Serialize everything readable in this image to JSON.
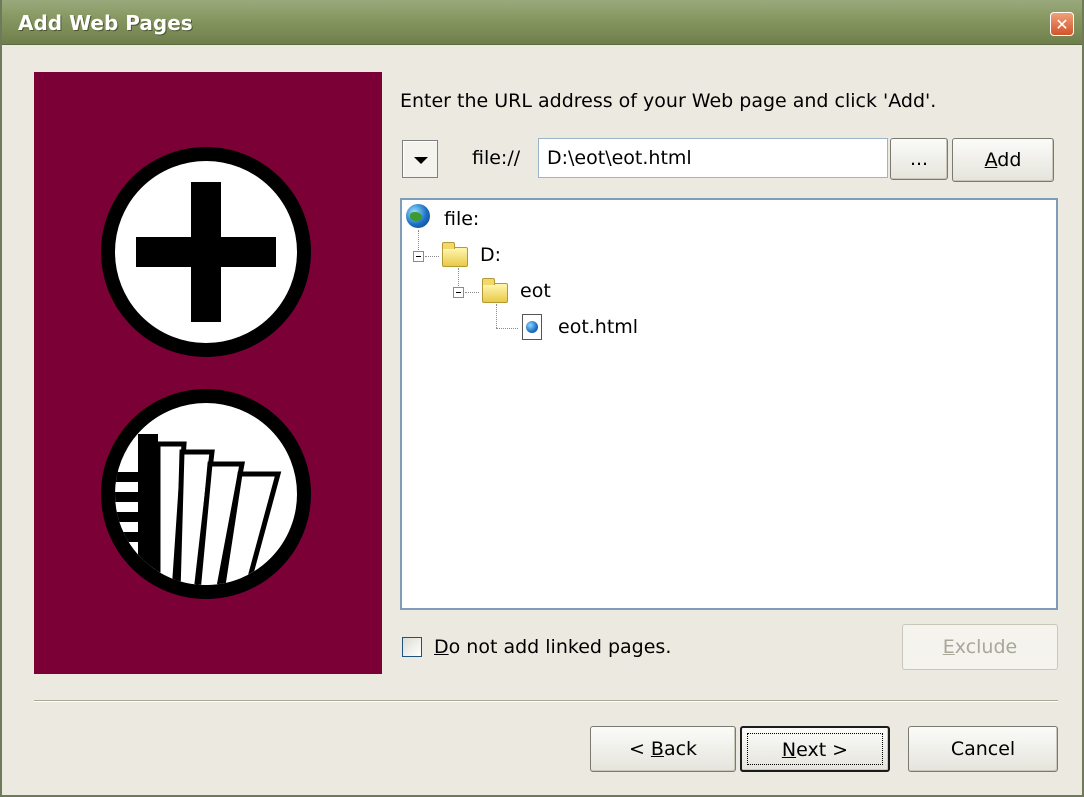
{
  "window": {
    "title": "Add Web Pages",
    "close_glyph": "✕"
  },
  "url_bar": {
    "instruction": "Enter the URL address of your Web page and click 'Add'.",
    "scheme": "file://",
    "value": "D:\\eot\\eot.html",
    "browse_label": "...",
    "add_label_mnemonic": "A",
    "add_label_rest": "dd"
  },
  "tree": {
    "root": {
      "label": "file:",
      "icon": "globe-icon"
    },
    "drive": {
      "label": "D:",
      "icon": "folder-icon"
    },
    "folder": {
      "label": "eot",
      "icon": "folder-icon"
    },
    "file": {
      "label": "eot.html",
      "icon": "html-file-icon"
    }
  },
  "options": {
    "no_linked_mnemonic": "D",
    "no_linked_rest": "o not add linked pages.",
    "no_linked_checked": false,
    "exclude_label_mnemonic": "E",
    "exclude_label_rest": "xclude"
  },
  "footer": {
    "back_prefix": "< ",
    "back_mnemonic": "B",
    "back_rest": "ack",
    "next_mnemonic": "N",
    "next_rest": "ext >",
    "cancel_label": "Cancel"
  },
  "colors": {
    "panel": "#7a0036",
    "titlebar": "#86965f"
  },
  "illustrations": [
    "add-circle-icon",
    "pages-circle-icon"
  ]
}
